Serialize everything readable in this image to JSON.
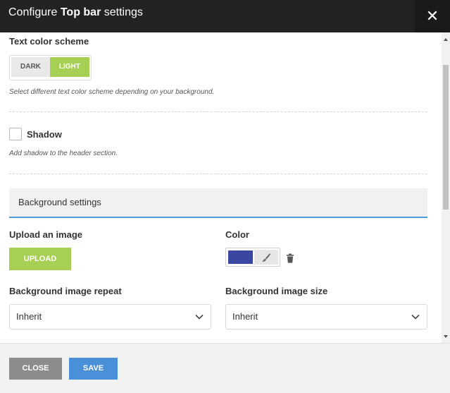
{
  "header": {
    "title_prefix": "Configure ",
    "title_bold": "Top bar",
    "title_suffix": " settings",
    "close_icon": "close-icon"
  },
  "text_color": {
    "label": "Text color scheme",
    "options": [
      "DARK",
      "LIGHT"
    ],
    "selected": "LIGHT",
    "hint": "Select different text color scheme depending on your background."
  },
  "shadow": {
    "label": "Shadow",
    "checked": false,
    "hint": "Add shadow to the header section."
  },
  "background": {
    "section_title": "Background settings",
    "upload_label": "Upload an image",
    "upload_button": "UPLOAD",
    "color_label": "Color",
    "color_value": "#3a46a0",
    "repeat_label": "Background image repeat",
    "repeat_value": "Inherit",
    "size_label": "Background image size",
    "size_value": "Inherit"
  },
  "footer": {
    "close_button": "CLOSE",
    "save_button": "SAVE"
  },
  "colors": {
    "accent_green": "#a6cf54",
    "accent_blue": "#4a90d9",
    "header_bg": "#222222"
  }
}
